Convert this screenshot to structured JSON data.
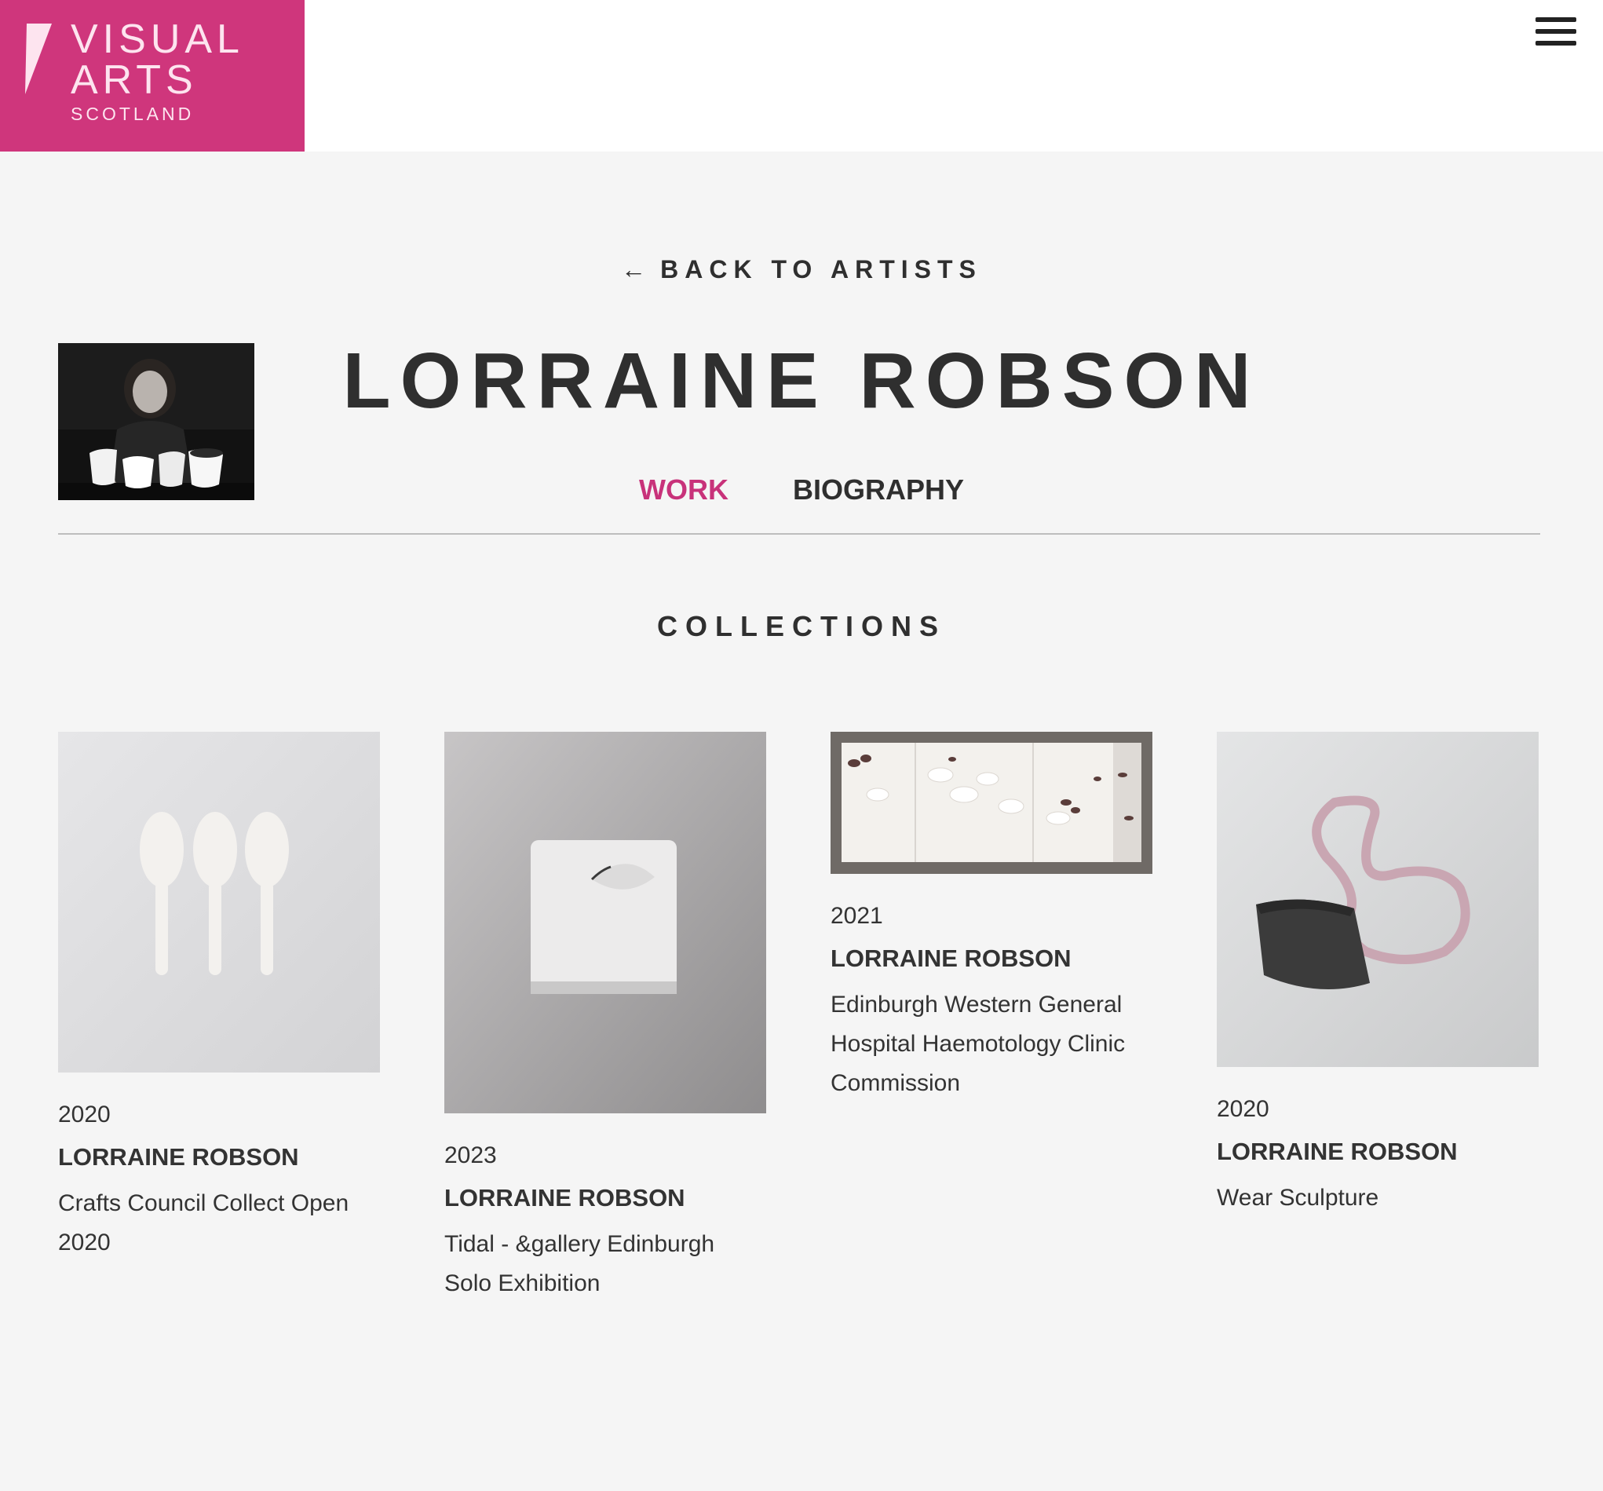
{
  "brand": {
    "line1": "VISUAL",
    "line2": "ARTS",
    "line3": "SCOTLAND",
    "color": "#cf367c"
  },
  "menu": {
    "icon": "hamburger-menu-icon"
  },
  "back_link": {
    "arrow": "←",
    "label": "BACK TO ARTISTS"
  },
  "artist": {
    "name": "LORRAINE ROBSON"
  },
  "tabs": [
    {
      "label": "WORK",
      "active": true
    },
    {
      "label": "BIOGRAPHY",
      "active": false
    }
  ],
  "accent_color": "#c8327a",
  "collections": {
    "title": "COLLECTIONS",
    "items": [
      {
        "year": "2020",
        "artist": "LORRAINE ROBSON",
        "title": "Crafts Council Collect Open 2020"
      },
      {
        "year": "2023",
        "artist": "LORRAINE ROBSON",
        "title": "Tidal - &gallery Edinburgh Solo Exhibition"
      },
      {
        "year": "2021",
        "artist": "LORRAINE ROBSON",
        "title": "Edinburgh Western General Hospital Haemotology Clinic Commission"
      },
      {
        "year": "2020",
        "artist": "LORRAINE ROBSON",
        "title": "Wear Sculpture"
      }
    ]
  }
}
